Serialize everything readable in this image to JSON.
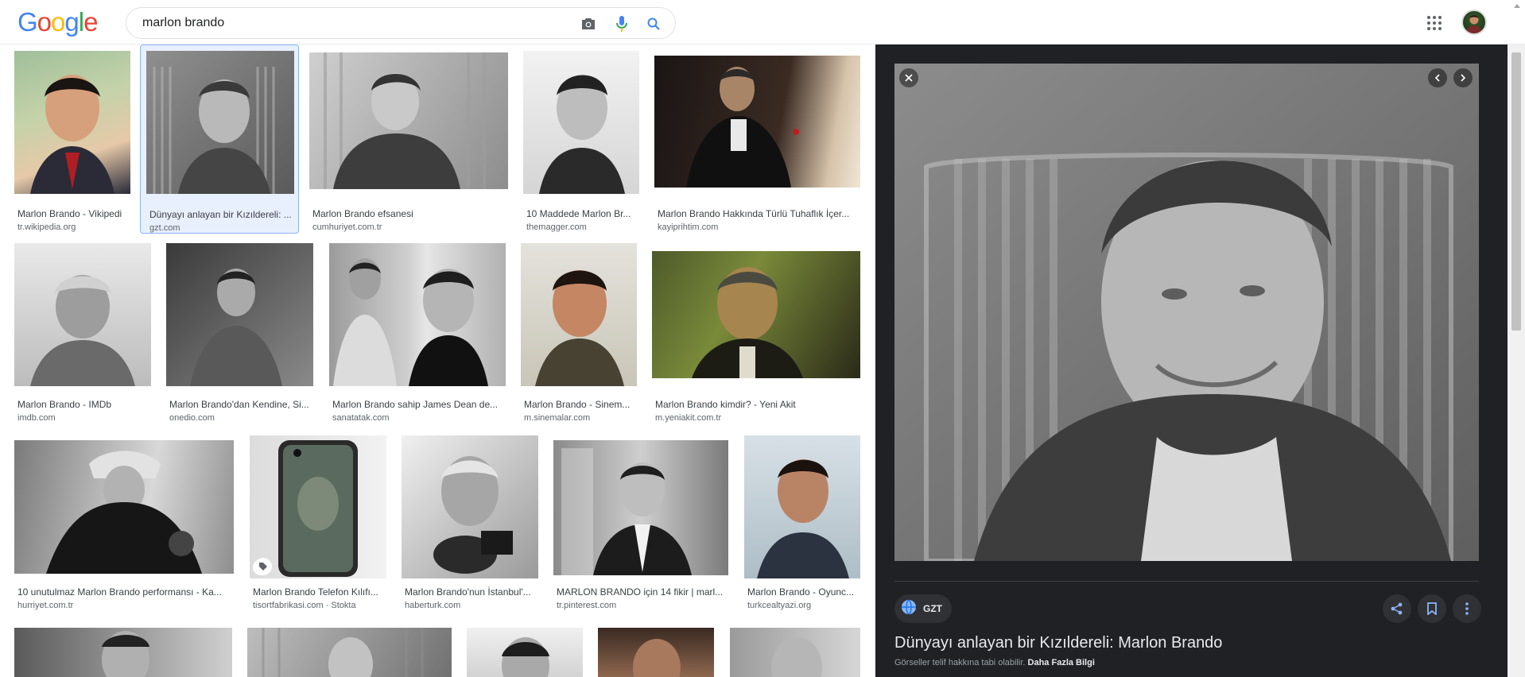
{
  "search": {
    "query": "marlon brando"
  },
  "logo": {
    "letters": [
      "G",
      "o",
      "o",
      "g",
      "l",
      "e"
    ],
    "colors": [
      "#4285f4",
      "#ea4335",
      "#fbbc05",
      "#4285f4",
      "#34a853",
      "#ea4335"
    ]
  },
  "results": [
    {
      "title": "Marlon Brando - Vikipedi",
      "source": "tr.wikipedia.org"
    },
    {
      "title": "Dünyayı anlayan bir Kızıldereli: ...",
      "source": "gzt.com",
      "selected": true
    },
    {
      "title": "Marlon Brando efsanesi",
      "source": "cumhuriyet.com.tr"
    },
    {
      "title": "10 Maddede Marlon Br...",
      "source": "themagger.com"
    },
    {
      "title": "Marlon Brando Hakkında Türlü Tuhaflık İçer...",
      "source": "kayiprihtim.com"
    },
    {
      "title": "Marlon Brando - IMDb",
      "source": "imdb.com"
    },
    {
      "title": "Marlon Brando'dan Kendine, Si...",
      "source": "onedio.com"
    },
    {
      "title": "Marlon Brando sahip James Dean de...",
      "source": "sanatatak.com"
    },
    {
      "title": "Marlon Brando - Sinem...",
      "source": "m.sinemalar.com"
    },
    {
      "title": "Marlon Brando kimdir? - Yeni Akit",
      "source": "m.yeniakit.com.tr"
    },
    {
      "title": "10 unutulmaz Marlon Brando performansı - Ka...",
      "source": "hurriyet.com.tr"
    },
    {
      "title": "Marlon Brando Telefon Kılıfı...",
      "source": "tisortfabrikasi.com · Stokta"
    },
    {
      "title": "Marlon Brando'nun İstanbul'...",
      "source": "haberturk.com"
    },
    {
      "title": "MARLON BRANDO için 14 fikir | marl...",
      "source": "tr.pinterest.com"
    },
    {
      "title": "Marlon Brando - Oyunc...",
      "source": "turkcealtyazi.org"
    },
    {
      "title": "",
      "source": ""
    },
    {
      "title": "",
      "source": ""
    },
    {
      "title": "",
      "source": ""
    },
    {
      "title": "",
      "source": ""
    },
    {
      "title": "",
      "source": ""
    }
  ],
  "preview": {
    "source_label": "GZT",
    "title": "Dünyayı anlayan bir Kızıldereli: Marlon Brando",
    "copyright": "Görseller telif hakkına tabi olabilir.",
    "more_info": "Daha Fazla Bilgi"
  },
  "icons": {
    "camera": "camera-icon",
    "mic": "microphone-icon",
    "search": "search-icon",
    "apps": "apps-grid-icon",
    "close": "close-icon",
    "prev": "chevron-left-icon",
    "next": "chevron-right-icon",
    "globe": "globe-icon",
    "share": "share-icon",
    "save": "bookmark-icon",
    "more": "more-vert-icon",
    "tag": "tag-icon"
  },
  "colors": {
    "panel_bg": "#202124",
    "selected_bg": "#e8f0fe",
    "selected_border": "#8ab4f8",
    "link_blue": "#4285f4"
  }
}
